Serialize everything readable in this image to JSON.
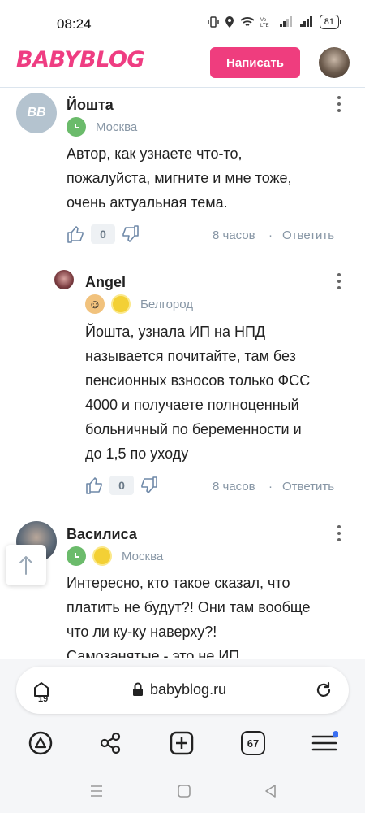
{
  "status": {
    "time": "08:24",
    "battery": "81"
  },
  "header": {
    "logo": "BABYBLOG",
    "write_label": "Написать"
  },
  "comments": [
    {
      "author": "Йошта",
      "avatar_initials": "BB",
      "city": "Москва",
      "text_lines": [
        "Автор, как узнаете что-то,",
        "пожалуйста, мигните и мне тоже,",
        "очень актуальная тема."
      ],
      "votes": "0",
      "time": "8 часов",
      "reply": "Ответить"
    },
    {
      "author": "Angel",
      "city": "Белгород",
      "text_lines": [
        "Йошта, узнала ИП на НПД",
        "называется почитайте, там без",
        "пенсионных взносов только ФСС",
        "4000 и получаете полноценный",
        "больничный по беременности и",
        "до 1,5 по уходу"
      ],
      "votes": "0",
      "time": "8 часов",
      "reply": "Ответить"
    },
    {
      "author": "Василиса",
      "city": "Москва",
      "text_lines": [
        "Интересно, кто такое сказал, что",
        "платить не будут?! Они там вообще",
        "что ли ку-ку наверху?!",
        "Самозанятые - это не ИП"
      ]
    }
  ],
  "browser": {
    "url": "babyblog.ru",
    "tab_badge": "19",
    "tabs_count": "67"
  },
  "colors": {
    "brand": "#ef3d82",
    "muted": "#8796a5",
    "online": "#6bbb6b"
  },
  "icons": [
    "like-icon",
    "dislike-icon",
    "more-icon",
    "scroll-top-icon",
    "lock-icon",
    "reload-icon",
    "share-icon",
    "add-tab-icon",
    "menu-icon",
    "home-icon"
  ]
}
